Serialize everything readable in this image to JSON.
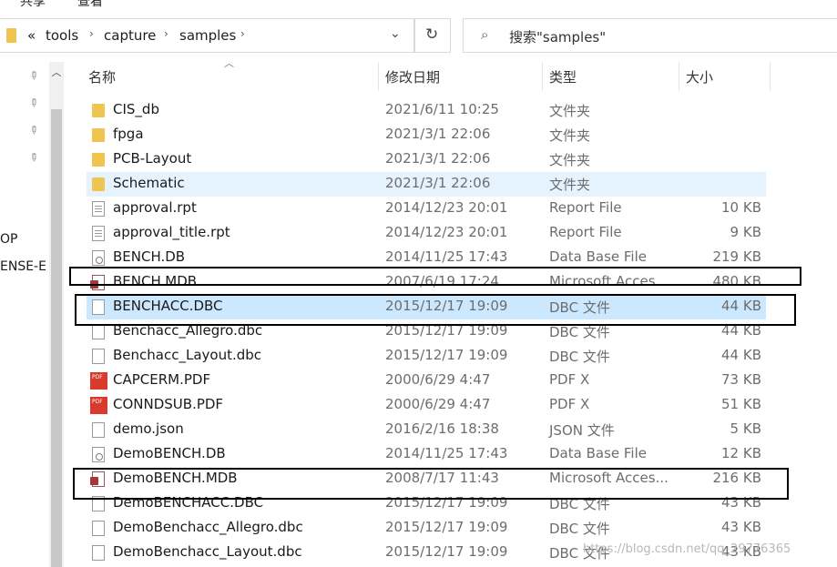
{
  "window": {
    "menu_items": [
      "共享",
      "查看"
    ]
  },
  "address_bar": {
    "overflow_marker": "«",
    "segments": [
      "tools",
      "capture",
      "samples"
    ],
    "chevron": "›",
    "dropdown_icon": "chevron-down-icon",
    "refresh_icon": "refresh-icon"
  },
  "search": {
    "placeholder": "搜索\"samples\"",
    "icon": "search-icon"
  },
  "nav_pane": {
    "pins": [
      "pin-icon",
      "pin-icon",
      "pin-icon",
      "pin-icon"
    ],
    "items": [
      "OP",
      "ENSE-E"
    ]
  },
  "columns": {
    "name": "名称",
    "date": "修改日期",
    "type": "类型",
    "size": "大小"
  },
  "files": [
    {
      "name": "CIS_db",
      "date": "2021/6/11 10:25",
      "type": "文件夹",
      "size": "",
      "icon": "folder"
    },
    {
      "name": "fpga",
      "date": "2021/3/1 22:06",
      "type": "文件夹",
      "size": "",
      "icon": "folder"
    },
    {
      "name": "PCB-Layout",
      "date": "2021/3/1 22:06",
      "type": "文件夹",
      "size": "",
      "icon": "folder"
    },
    {
      "name": "Schematic",
      "date": "2021/3/1 22:06",
      "type": "文件夹",
      "size": "",
      "icon": "folder"
    },
    {
      "name": "approval.rpt",
      "date": "2014/12/23 20:01",
      "type": "Report File",
      "size": "10 KB",
      "icon": "rpt"
    },
    {
      "name": "approval_title.rpt",
      "date": "2014/12/23 20:01",
      "type": "Report File",
      "size": "9 KB",
      "icon": "rpt"
    },
    {
      "name": "BENCH.DB",
      "date": "2014/11/25 17:43",
      "type": "Data Base File",
      "size": "219 KB",
      "icon": "db"
    },
    {
      "name": "BENCH.MDB",
      "date": "2007/6/19 17:24",
      "type": "Microsoft Acces...",
      "size": "480 KB",
      "icon": "mdb"
    },
    {
      "name": "BENCHACC.DBC",
      "date": "2015/12/17 19:09",
      "type": "DBC 文件",
      "size": "44 KB",
      "icon": "doc"
    },
    {
      "name": "Benchacc_Allegro.dbc",
      "date": "2015/12/17 19:09",
      "type": "DBC 文件",
      "size": "44 KB",
      "icon": "doc"
    },
    {
      "name": "Benchacc_Layout.dbc",
      "date": "2015/12/17 19:09",
      "type": "DBC 文件",
      "size": "44 KB",
      "icon": "doc"
    },
    {
      "name": "CAPCERM.PDF",
      "date": "2000/6/29 4:47",
      "type": "PDF X",
      "size": "73 KB",
      "icon": "pdf"
    },
    {
      "name": "CONNDSUB.PDF",
      "date": "2000/6/29 4:47",
      "type": "PDF X",
      "size": "51 KB",
      "icon": "pdf"
    },
    {
      "name": "demo.json",
      "date": "2016/2/16 18:38",
      "type": "JSON 文件",
      "size": "5 KB",
      "icon": "doc"
    },
    {
      "name": "DemoBENCH.DB",
      "date": "2014/11/25 17:43",
      "type": "Data Base File",
      "size": "12 KB",
      "icon": "db"
    },
    {
      "name": "DemoBENCH.MDB",
      "date": "2008/7/17 11:43",
      "type": "Microsoft Acces...",
      "size": "216 KB",
      "icon": "mdb"
    },
    {
      "name": "DemoBENCHACC.DBC",
      "date": "2015/12/17 19:09",
      "type": "DBC 文件",
      "size": "43 KB",
      "icon": "doc"
    },
    {
      "name": "DemoBenchacc_Allegro.dbc",
      "date": "2015/12/17 19:09",
      "type": "DBC 文件",
      "size": "43 KB",
      "icon": "doc"
    },
    {
      "name": "DemoBenchacc_Layout.dbc",
      "date": "2015/12/17 19:09",
      "type": "DBC 文件",
      "size": "43 KB",
      "icon": "doc"
    }
  ],
  "selection": {
    "hover_row": "Schematic",
    "selected_row": "BENCHACC.DBC",
    "colors": {
      "hover": "#e5f3ff",
      "selected": "#cce8ff"
    }
  },
  "annotations": {
    "boxed_rows": [
      "BENCH.MDB",
      "BENCHACC.DBC",
      "DemoBENCH.MDB"
    ],
    "color": "#000000"
  },
  "watermark": "https://blog.csdn.net/qq_29776365"
}
